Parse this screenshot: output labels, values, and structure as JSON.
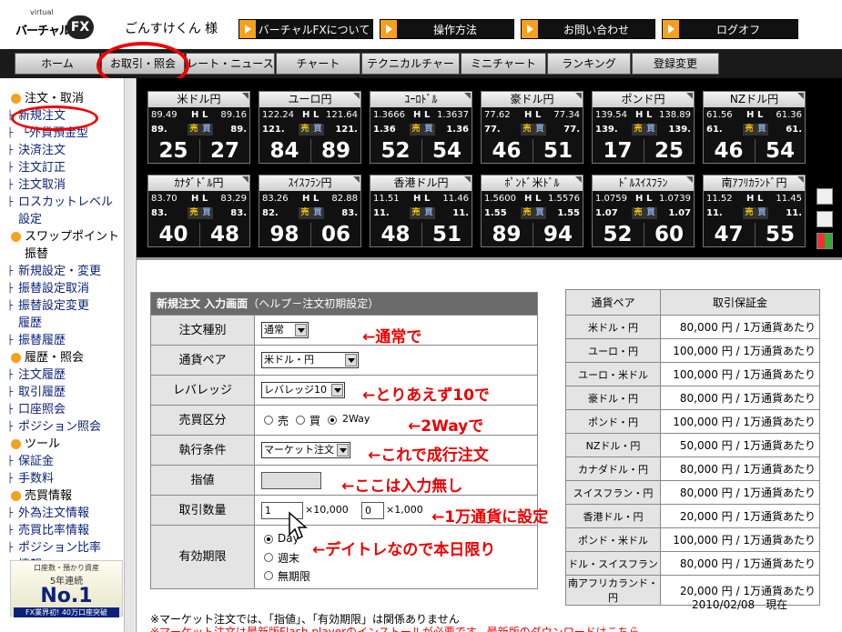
{
  "header": {
    "logo_small": "virtual",
    "logo_text": "バーチャル",
    "logo_fx": "FX",
    "username": "ごんすけくん 様",
    "buttons": [
      "バーチャルFXについて",
      "操作方法",
      "お問い合わせ",
      "ログオフ"
    ],
    "accent": "#f5a01e"
  },
  "nav": {
    "items": [
      "ホーム",
      "お取引・照会",
      "レート・ニュース",
      "チャート",
      "テクニカルチャート",
      "ミニチャート",
      "ランキング",
      "登録変更"
    ]
  },
  "sidebar": {
    "items": [
      {
        "t": "注文・取消",
        "k": "hd"
      },
      {
        "t": "新規注文",
        "k": "sub"
      },
      {
        "t": " └外貨預金型",
        "k": "sub"
      },
      {
        "t": "決済注文",
        "k": "sub"
      },
      {
        "t": "注文訂正",
        "k": "sub"
      },
      {
        "t": "注文取消",
        "k": "sub"
      },
      {
        "t": "ロスカットレベル\n設定",
        "k": "sub"
      },
      {
        "t": "スワップポイント\n振替",
        "k": "hd"
      },
      {
        "t": "新規設定・変更",
        "k": "sub"
      },
      {
        "t": "振替設定取消",
        "k": "sub"
      },
      {
        "t": "振替設定変更\n履歴",
        "k": "sub"
      },
      {
        "t": "振替履歴",
        "k": "sub"
      },
      {
        "t": "履歴・照会",
        "k": "hd"
      },
      {
        "t": "注文履歴",
        "k": "sub"
      },
      {
        "t": "取引履歴",
        "k": "sub"
      },
      {
        "t": "口座照会",
        "k": "sub"
      },
      {
        "t": "ポジション照会",
        "k": "sub"
      },
      {
        "t": "ツール",
        "k": "hd"
      },
      {
        "t": "保証金",
        "k": "sub"
      },
      {
        "t": "手数料",
        "k": "sub"
      },
      {
        "t": "売買情報",
        "k": "hd"
      },
      {
        "t": "外為注文情報",
        "k": "sub"
      },
      {
        "t": "売買比率情報",
        "k": "sub"
      },
      {
        "t": "ポジション比率\n情報",
        "k": "sub"
      }
    ],
    "banner": {
      "line1": "口座数・預かり資産",
      "line2": "5年連続",
      "line3": "No.1",
      "line4": "FX業界初! 40万口座突破"
    }
  },
  "rates": {
    "H": "H",
    "L": "L",
    "sell": "売",
    "buy": "買",
    "cards": [
      {
        "name": "米ドル円",
        "low": "89.49",
        "high": "89.16",
        "bid_int": "89.",
        "ask_int": "89.",
        "bid": "25",
        "ask": "27"
      },
      {
        "name": "ユーロ円",
        "low": "122.24",
        "high": "121.64",
        "bid_int": "121.",
        "ask_int": "121.",
        "bid": "84",
        "ask": "89"
      },
      {
        "name": "ﾕｰﾛﾄﾞﾙ",
        "low": "1.3666",
        "high": "1.3637",
        "bid_int": "1.36",
        "ask_int": "1.36",
        "bid": "52",
        "ask": "54"
      },
      {
        "name": "豪ドル円",
        "low": "77.62",
        "high": "77.34",
        "bid_int": "77.",
        "ask_int": "77.",
        "bid": "46",
        "ask": "51"
      },
      {
        "name": "ポンド円",
        "low": "139.54",
        "high": "138.89",
        "bid_int": "139.",
        "ask_int": "139.",
        "bid": "17",
        "ask": "25"
      },
      {
        "name": "NZドル円",
        "low": "61.56",
        "high": "61.36",
        "bid_int": "61.",
        "ask_int": "61.",
        "bid": "46",
        "ask": "54"
      },
      {
        "name": "ｶﾅﾀﾞﾄﾞﾙ円",
        "low": "83.70",
        "high": "83.29",
        "bid_int": "83.",
        "ask_int": "83.",
        "bid": "40",
        "ask": "48"
      },
      {
        "name": "ｽｲｽﾌﾗﾝ円",
        "low": "83.26",
        "high": "82.88",
        "bid_int": "82.",
        "ask_int": "83.",
        "bid": "98",
        "ask": "06"
      },
      {
        "name": "香港ドル円",
        "low": "11.51",
        "high": "11.46",
        "bid_int": "11.",
        "ask_int": "11.",
        "bid": "48",
        "ask": "51"
      },
      {
        "name": "ﾎﾟﾝﾄﾞ米ﾄﾞﾙ",
        "low": "1.5600",
        "high": "1.5576",
        "bid_int": "1.55",
        "ask_int": "1.55",
        "bid": "89",
        "ask": "94"
      },
      {
        "name": "ﾄﾞﾙｽｲｽﾌﾗﾝ",
        "low": "1.0759",
        "high": "1.0739",
        "bid_int": "1.07",
        "ask_int": "1.07",
        "bid": "52",
        "ask": "60"
      },
      {
        "name": "南ｱﾌﾘｶﾗﾝﾄﾞ円",
        "low": "11.52",
        "high": "11.45",
        "bid_int": "11.",
        "ask_int": "11.",
        "bid": "47",
        "ask": "55"
      }
    ]
  },
  "form": {
    "title_bold": "新規注文 入力画面",
    "title_rest": "（ヘルプ－注文初期設定）",
    "rows": {
      "order_type": {
        "label": "注文種別",
        "value": "通常"
      },
      "pair": {
        "label": "通貨ペア",
        "value": "米ドル・円"
      },
      "leverage": {
        "label": "レバレッジ",
        "value": "レバレッジ10"
      },
      "side": {
        "label": "売買区分",
        "options": [
          "売",
          "買",
          "2Way"
        ],
        "selected": "2Way"
      },
      "exec": {
        "label": "執行条件",
        "value": "マーケット注文"
      },
      "price": {
        "label": "指値",
        "value": ""
      },
      "qty": {
        "label": "取引数量",
        "value1": "1",
        "unit1": "×10,000",
        "value2": "0",
        "unit2": "×1,000"
      },
      "expiry": {
        "label": "有効期限",
        "options": [
          "Day",
          "週末",
          "無期限"
        ],
        "selected": "Day"
      }
    }
  },
  "annotations": {
    "order_type": "←通常で",
    "leverage": "←とりあえず10で",
    "side": "←2Wayで",
    "exec": "←これで成行注文",
    "price": "←ここは入力無し",
    "qty": "←1万通貨に設定",
    "expiry": "←デイトレなので本日限り",
    "color": "#e00000"
  },
  "margin_table": {
    "headers": [
      "通貨ペア",
      "取引保証金"
    ],
    "rows": [
      [
        "米ドル・円",
        "80,000 円 / 1万通貨あたり"
      ],
      [
        "ユーロ・円",
        "100,000 円 / 1万通貨あたり"
      ],
      [
        "ユーロ・米ドル",
        "100,000 円 / 1万通貨あたり"
      ],
      [
        "豪ドル・円",
        "80,000 円 / 1万通貨あたり"
      ],
      [
        "ポンド・円",
        "100,000 円 / 1万通貨あたり"
      ],
      [
        "NZドル・円",
        "50,000 円 / 1万通貨あたり"
      ],
      [
        "カナダドル・円",
        "80,000 円 / 1万通貨あたり"
      ],
      [
        "スイスフラン・円",
        "80,000 円 / 1万通貨あたり"
      ],
      [
        "香港ドル・円",
        "20,000 円 / 1万通貨あたり"
      ],
      [
        "ポンド・米ドル",
        "100,000 円 / 1万通貨あたり"
      ],
      [
        "ドル・スイスフラン",
        "80,000 円 / 1万通貨あたり"
      ],
      [
        "南アフリカランド・円",
        "20,000 円 / 1万通貨あたり"
      ]
    ],
    "date": "2010/02/08　現在"
  },
  "footer": {
    "note1": "※マーケット注文では、「指値」、「有効期限」は関係ありません",
    "note2": "※マーケット注文は最新版Flash playerのインストールが必要です。最新版のダウンロードはこちら"
  }
}
